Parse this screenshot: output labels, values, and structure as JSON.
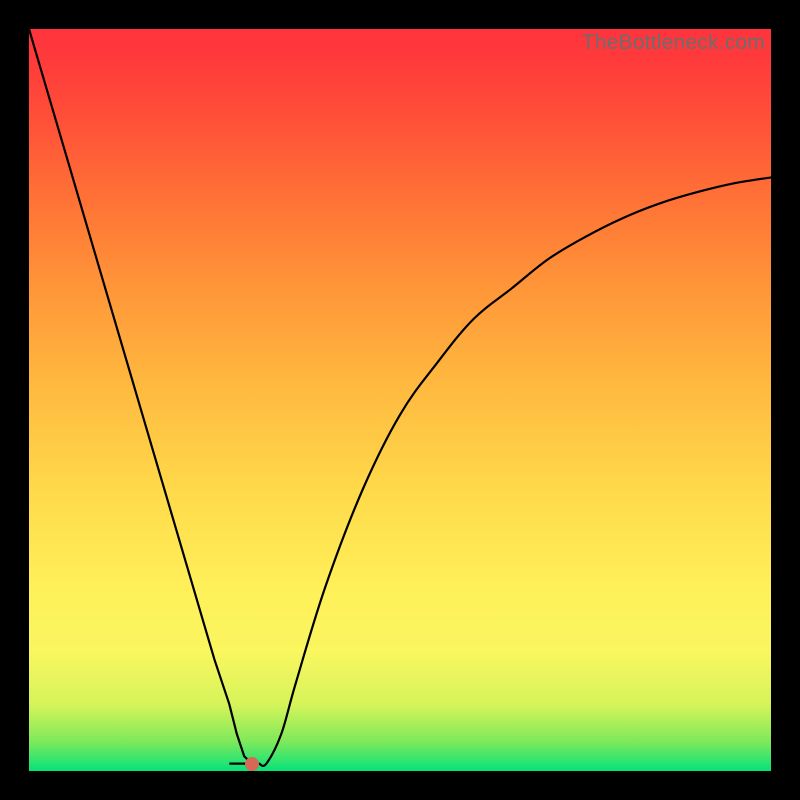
{
  "watermark": "TheBottleneck.com",
  "chart_data": {
    "type": "line",
    "title": "",
    "xlabel": "",
    "ylabel": "",
    "xlim": [
      0,
      100
    ],
    "ylim": [
      0,
      100
    ],
    "x": [
      0,
      5,
      10,
      15,
      20,
      25,
      27,
      28,
      29,
      30,
      31,
      32,
      34,
      36,
      40,
      45,
      50,
      55,
      60,
      65,
      70,
      75,
      80,
      85,
      90,
      95,
      100
    ],
    "values": [
      100,
      83,
      66,
      49,
      32,
      15,
      9,
      5,
      2,
      1,
      1,
      1,
      5,
      12,
      25,
      38,
      48,
      55,
      61,
      65,
      69,
      72,
      74.5,
      76.5,
      78,
      79.2,
      80
    ],
    "minimum_point": {
      "x": 30,
      "y": 1
    },
    "dot_color": "#d46a56",
    "line_color": "#000000",
    "line_width": 2
  }
}
